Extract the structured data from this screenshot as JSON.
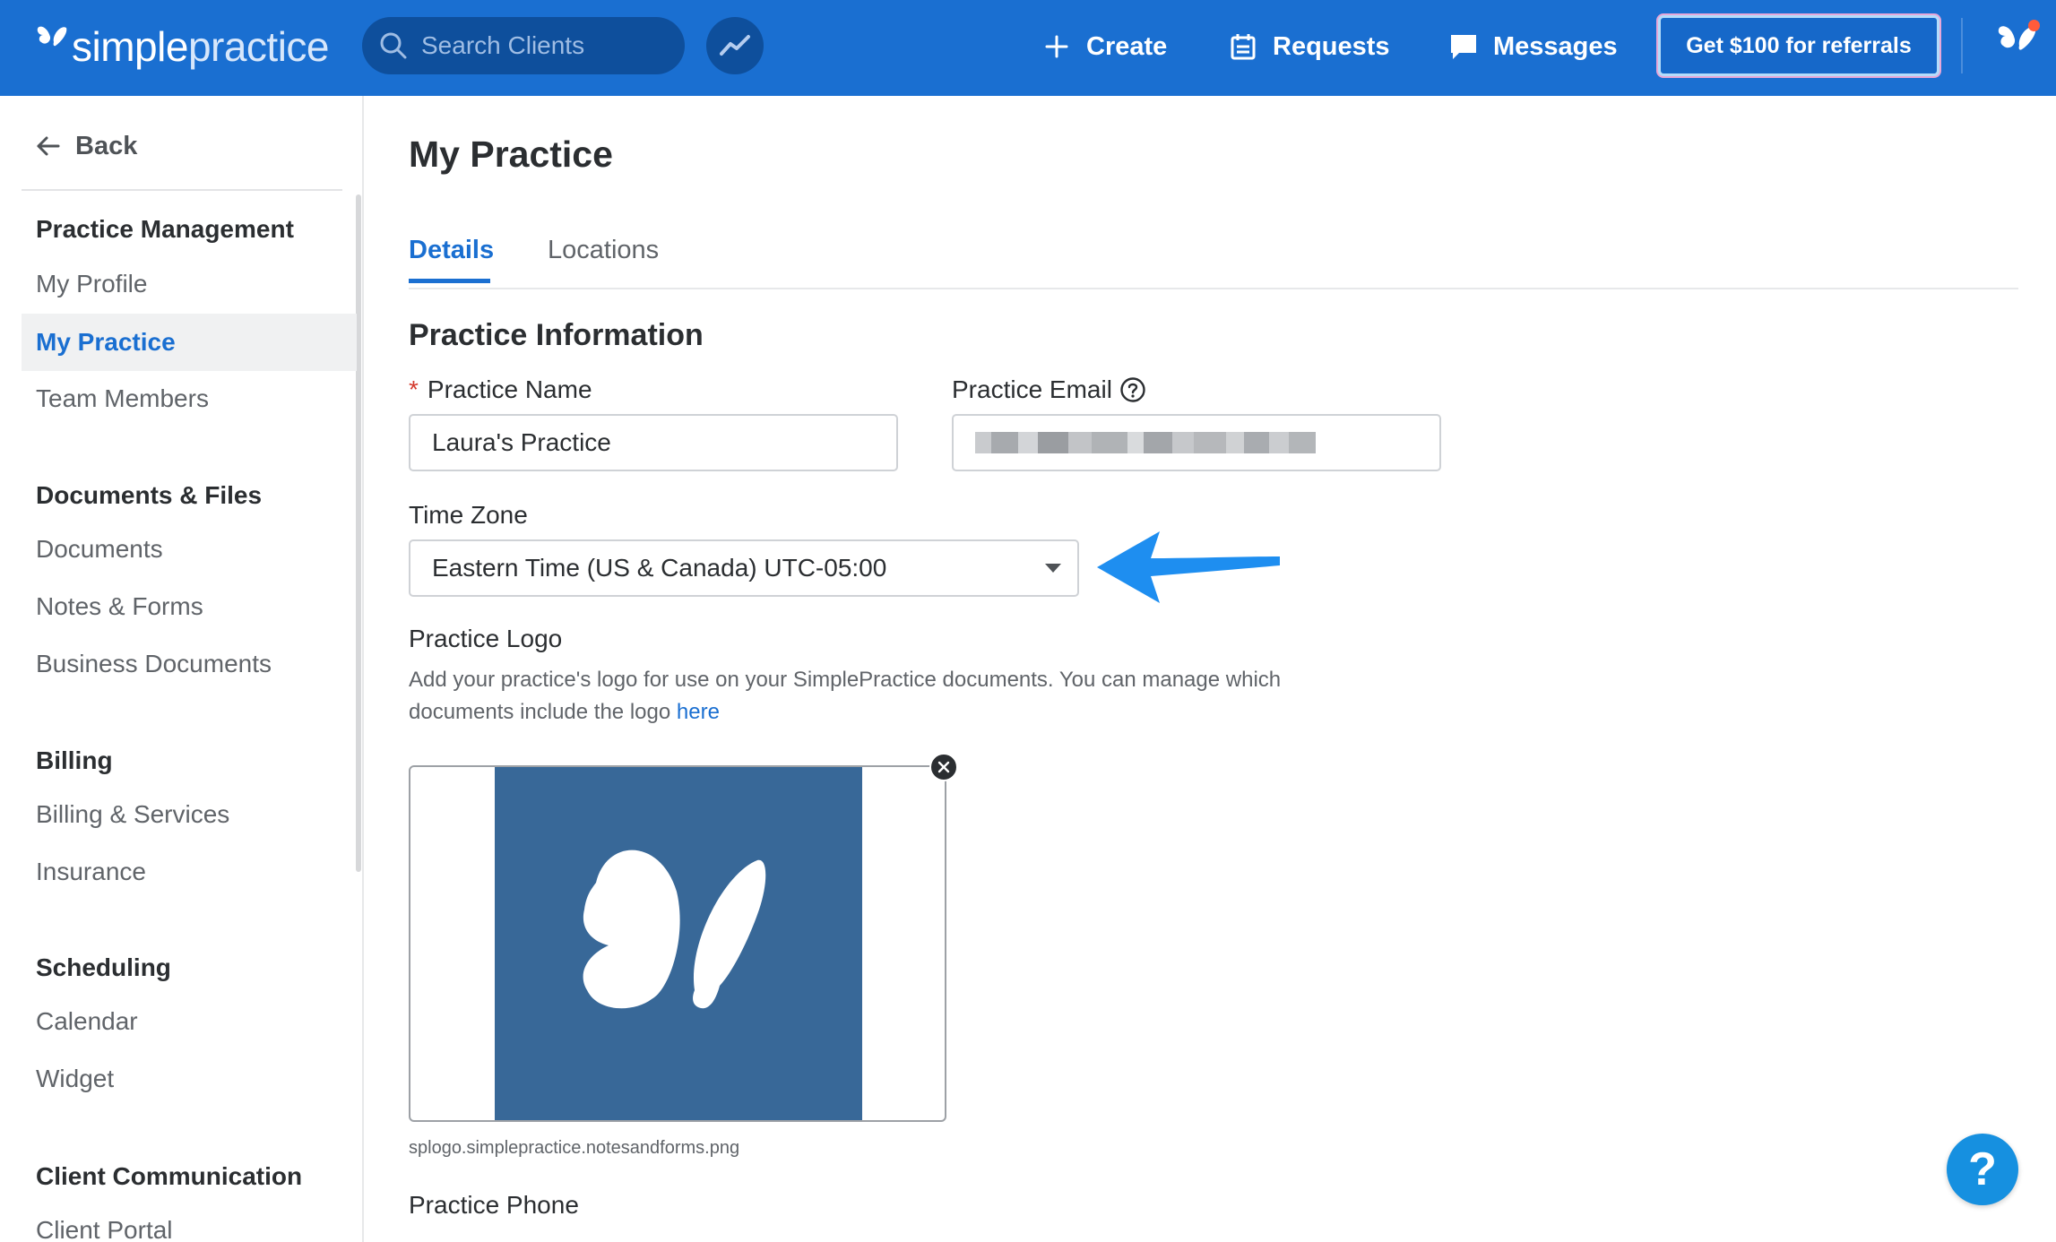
{
  "topbar": {
    "brand_part1": "simple",
    "brand_part2": "practice",
    "search_placeholder": "Search Clients",
    "create_label": "Create",
    "requests_label": "Requests",
    "messages_label": "Messages",
    "referral_label": "Get $100 for referrals",
    "icons": [
      "butterfly-logo-icon",
      "search-icon",
      "insights-chart-icon",
      "plus-icon",
      "calendar-icon",
      "chat-bubble-icon",
      "avatar-butterfly-icon"
    ]
  },
  "sidebar": {
    "back_label": "Back",
    "sections": [
      {
        "heading": "Practice Management",
        "items": [
          "My Profile",
          "My Practice",
          "Team Members"
        ]
      },
      {
        "heading": "Documents & Files",
        "items": [
          "Documents",
          "Notes & Forms",
          "Business Documents"
        ]
      },
      {
        "heading": "Billing",
        "items": [
          "Billing & Services",
          "Insurance"
        ]
      },
      {
        "heading": "Scheduling",
        "items": [
          "Calendar",
          "Widget"
        ]
      },
      {
        "heading": "Client Communication",
        "items": [
          "Client Portal"
        ]
      }
    ],
    "active_item": "My Practice"
  },
  "main": {
    "page_title": "My Practice",
    "tabs": [
      {
        "label": "Details",
        "active": true
      },
      {
        "label": "Locations",
        "active": false
      }
    ],
    "section_title": "Practice Information",
    "practice_name": {
      "required_mark": "*",
      "label": "Practice Name",
      "value": "Laura's Practice"
    },
    "practice_email": {
      "label": "Practice Email"
    },
    "time_zone": {
      "label": "Time Zone",
      "value": "Eastern Time (US & Canada) UTC-05:00"
    },
    "practice_logo": {
      "label": "Practice Logo",
      "description": "Add your practice's logo for use on your SimplePractice documents. You can manage which documents include the logo",
      "link_text": "here",
      "filename": "splogo.simplepractice.notesandforms.png"
    },
    "practice_phone_label": "Practice Phone"
  },
  "help_button": "?",
  "colors": {
    "brand_blue": "#1a6fd1",
    "search_bg": "#0e4f9c",
    "logo_tile": "#386898",
    "annotation_arrow": "#1e8ef0",
    "required_red": "#d43b2e"
  }
}
